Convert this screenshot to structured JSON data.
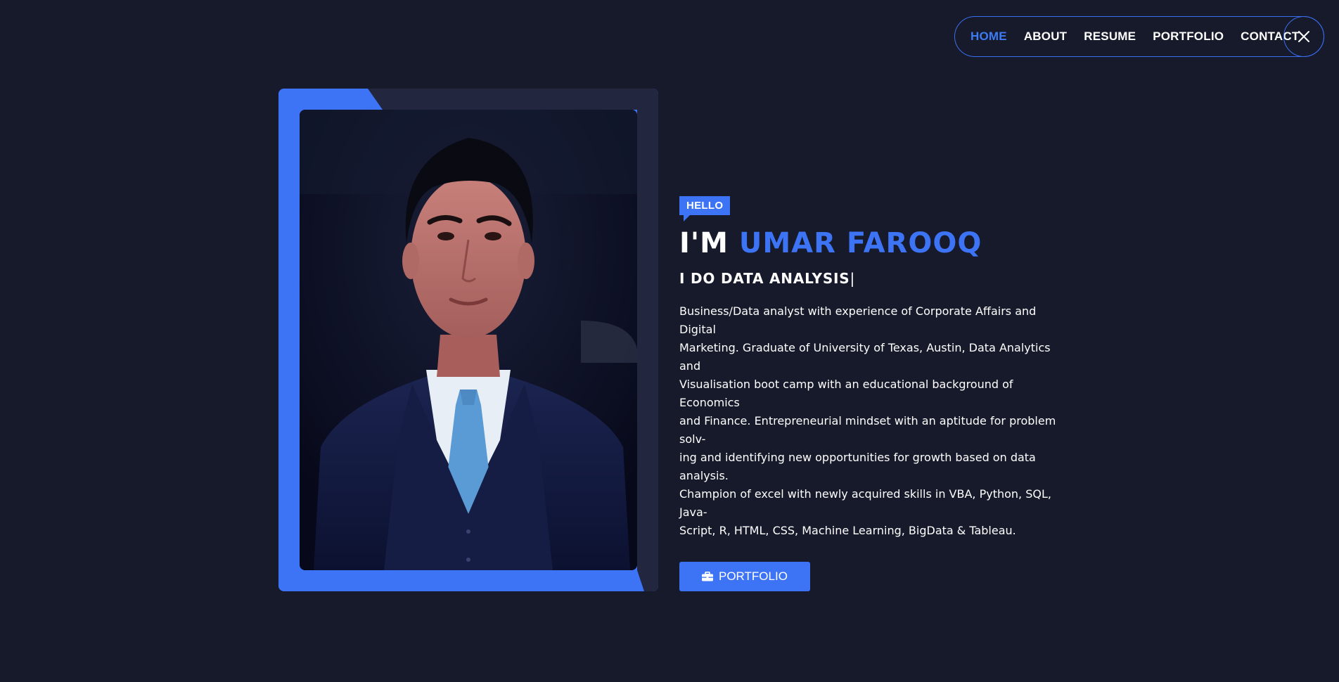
{
  "nav": {
    "items": [
      {
        "label": "HOME",
        "active": true
      },
      {
        "label": "ABOUT",
        "active": false
      },
      {
        "label": "RESUME",
        "active": false
      },
      {
        "label": "PORTFOLIO",
        "active": false
      },
      {
        "label": "CONTACT",
        "active": false
      }
    ],
    "close_icon": "close-icon"
  },
  "intro": {
    "badge": "HELLO",
    "headline_prefix": "I'M ",
    "headline_name": "UMAR FAROOQ",
    "typed_text": "I DO DATA ANALYSIS",
    "caret": "|",
    "bio_lines": [
      "Business/Data analyst with experience of Corporate Affairs and Digital",
      "Marketing. Graduate of University of Texas, Austin, Data Analytics and",
      "Visualisation boot camp with an educational background of Economics",
      "and Finance. Entrepreneurial mindset with an aptitude for problem solv-",
      "ing and identifying new opportunities for growth based on data analysis.",
      "Champion of excel with newly acquired skills in VBA, Python, SQL, Java-",
      "Script, R, HTML, CSS, Machine Learning, BigData & Tableau."
    ],
    "button_label": "PORTFOLIO",
    "button_icon": "briefcase-icon"
  },
  "colors": {
    "background": "#161a2b",
    "accent": "#3d73f5",
    "card_dark": "#22273f",
    "text": "#ffffff"
  }
}
